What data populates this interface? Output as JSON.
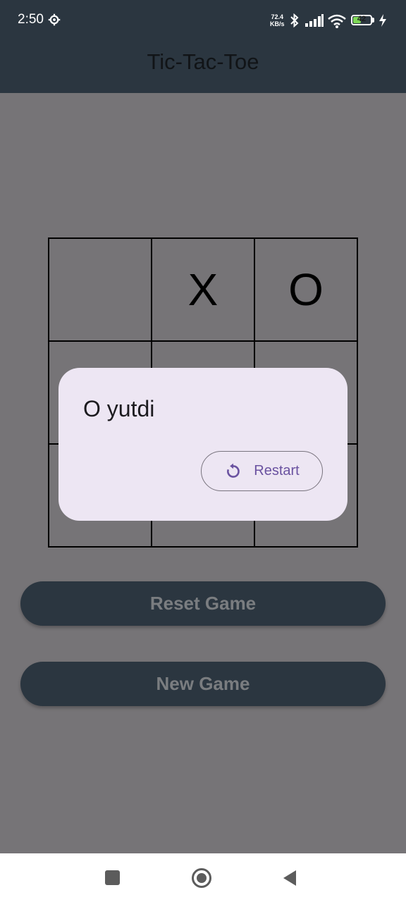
{
  "status_bar": {
    "time": "2:50",
    "net_speed_value": "72.4",
    "net_speed_unit": "KB/s",
    "battery": "42",
    "battery_level": 0.42,
    "icons": [
      "gear-icon",
      "bluetooth-icon",
      "signal-icon",
      "wifi-icon",
      "battery-icon",
      "charging-icon"
    ]
  },
  "app_bar": {
    "title": "Tic-Tac-Toe"
  },
  "board": {
    "cells": [
      "",
      "X",
      "O",
      "",
      "",
      "",
      "",
      "",
      ""
    ]
  },
  "buttons": {
    "reset_label": "Reset Game",
    "new_label": "New Game"
  },
  "dialog": {
    "message": "O yutdi",
    "restart_label": "Restart",
    "restart_icon": "restart-icon"
  },
  "nav_bar": {
    "icons": [
      "recents-icon",
      "home-icon",
      "back-icon"
    ]
  },
  "colors": {
    "app_bar": "#2b3640",
    "scrim_background": "#767477",
    "dialog": "#ede6f3",
    "accent": "#6a52a0"
  }
}
